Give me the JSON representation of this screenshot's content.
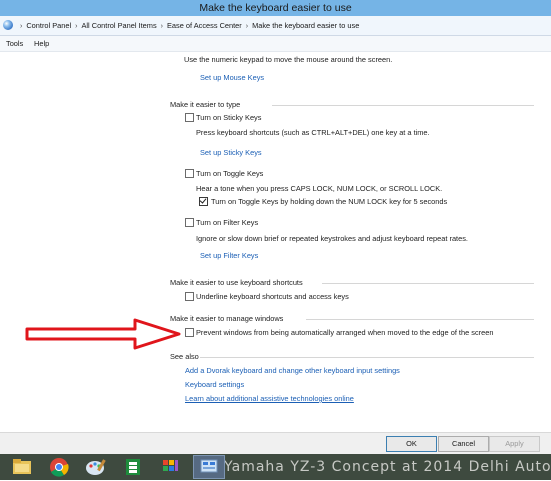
{
  "window": {
    "title": "Make the keyboard easier to use"
  },
  "address": {
    "crumbs": [
      "Control Panel",
      "All Control Panel Items",
      "Ease of Access Center",
      "Make the keyboard easier to use"
    ]
  },
  "menu": {
    "tools": "Tools",
    "help": "Help"
  },
  "mouse_keys": {
    "description": "Use the numeric keypad to move the mouse around the screen.",
    "setup_link": "Set up Mouse Keys"
  },
  "typing": {
    "header": "Make it easier to type",
    "sticky": {
      "label": "Turn on Sticky Keys",
      "checked": false,
      "description": "Press keyboard shortcuts (such as CTRL+ALT+DEL) one key at a time.",
      "setup_link": "Set up Sticky Keys"
    },
    "toggle": {
      "label": "Turn on Toggle Keys",
      "checked": false,
      "description": "Hear a tone when you press CAPS LOCK, NUM LOCK, or SCROLL LOCK.",
      "sub_label": "Turn on Toggle Keys by holding down the NUM LOCK key for 5 seconds",
      "sub_checked": true
    },
    "filter": {
      "label": "Turn on Filter Keys",
      "checked": false,
      "description": "Ignore or slow down brief or repeated keystrokes and adjust keyboard repeat rates.",
      "setup_link": "Set up Filter Keys"
    }
  },
  "shortcuts": {
    "header": "Make it easier to use keyboard shortcuts",
    "underline_label": "Underline keyboard shortcuts and access keys",
    "underline_checked": false
  },
  "windows": {
    "header": "Make it easier to manage windows",
    "prevent_label": "Prevent windows from being automatically arranged when moved to the edge of the screen",
    "prevent_checked": false
  },
  "see_also": {
    "header": "See also",
    "links": [
      "Add a Dvorak keyboard and change other keyboard input settings",
      "Keyboard settings",
      "Learn about additional assistive technologies online"
    ]
  },
  "buttons": {
    "ok": "OK",
    "cancel": "Cancel",
    "apply": "Apply"
  },
  "taskbar": {
    "background_text": "Yamaha YZ-3 Concept at 2014 Delhi Auto",
    "items": [
      "file-explorer-icon",
      "chrome-icon",
      "paint-icon",
      "office-icon",
      "store-icon",
      "control-panel-icon"
    ]
  },
  "colors": {
    "title_bar": "#75b4e6",
    "link": "#1b5fb5",
    "annotation_arrow": "#e0151b"
  }
}
